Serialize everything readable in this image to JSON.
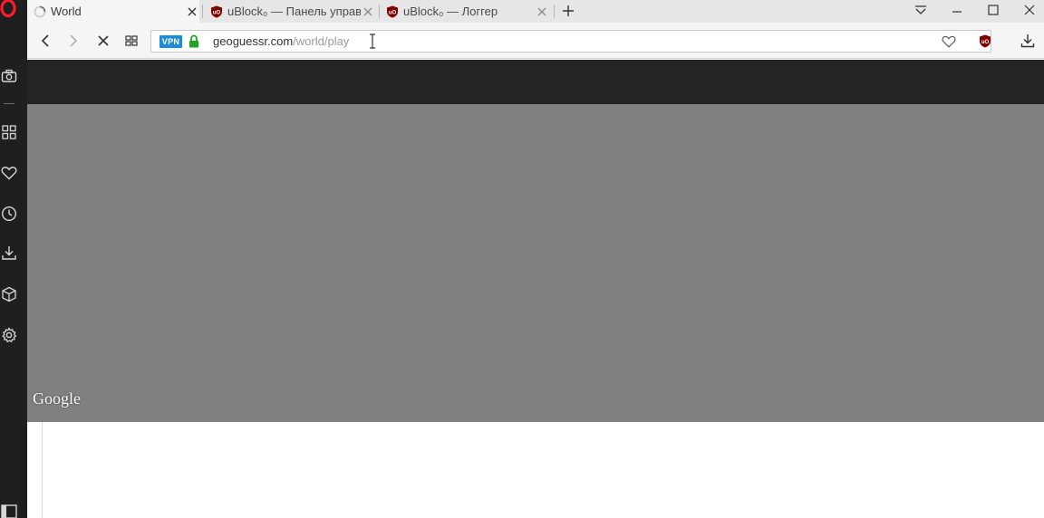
{
  "tabs": [
    {
      "label": "World",
      "icon": "loading-spinner-icon",
      "active": true
    },
    {
      "label": "uBlock₀ — Панель управл",
      "icon": "ublock-icon",
      "active": false
    },
    {
      "label": "uBlock₀ — Логгер",
      "icon": "ublock-icon",
      "active": false
    }
  ],
  "address_bar": {
    "vpn_label": "VPN",
    "domain": "geoguessr.com",
    "path": "/world/play"
  },
  "map": {
    "attribution": "Google"
  },
  "colors": {
    "opera_red": "#ff1b2d",
    "ublock_red": "#800000",
    "vpn_blue": "#1a8cd8",
    "lock_green": "#1fa81f",
    "sidebar_bg": "#1f1f1f",
    "page_header_bg": "#242424",
    "map_bg": "#808080"
  },
  "sidebar_icons": [
    "snapshot-icon",
    "speed-dial-icon",
    "bookmarks-heart-icon",
    "history-clock-icon",
    "downloads-icon",
    "extensions-cube-icon",
    "settings-gear-icon",
    "sidebar-toggle-icon"
  ]
}
